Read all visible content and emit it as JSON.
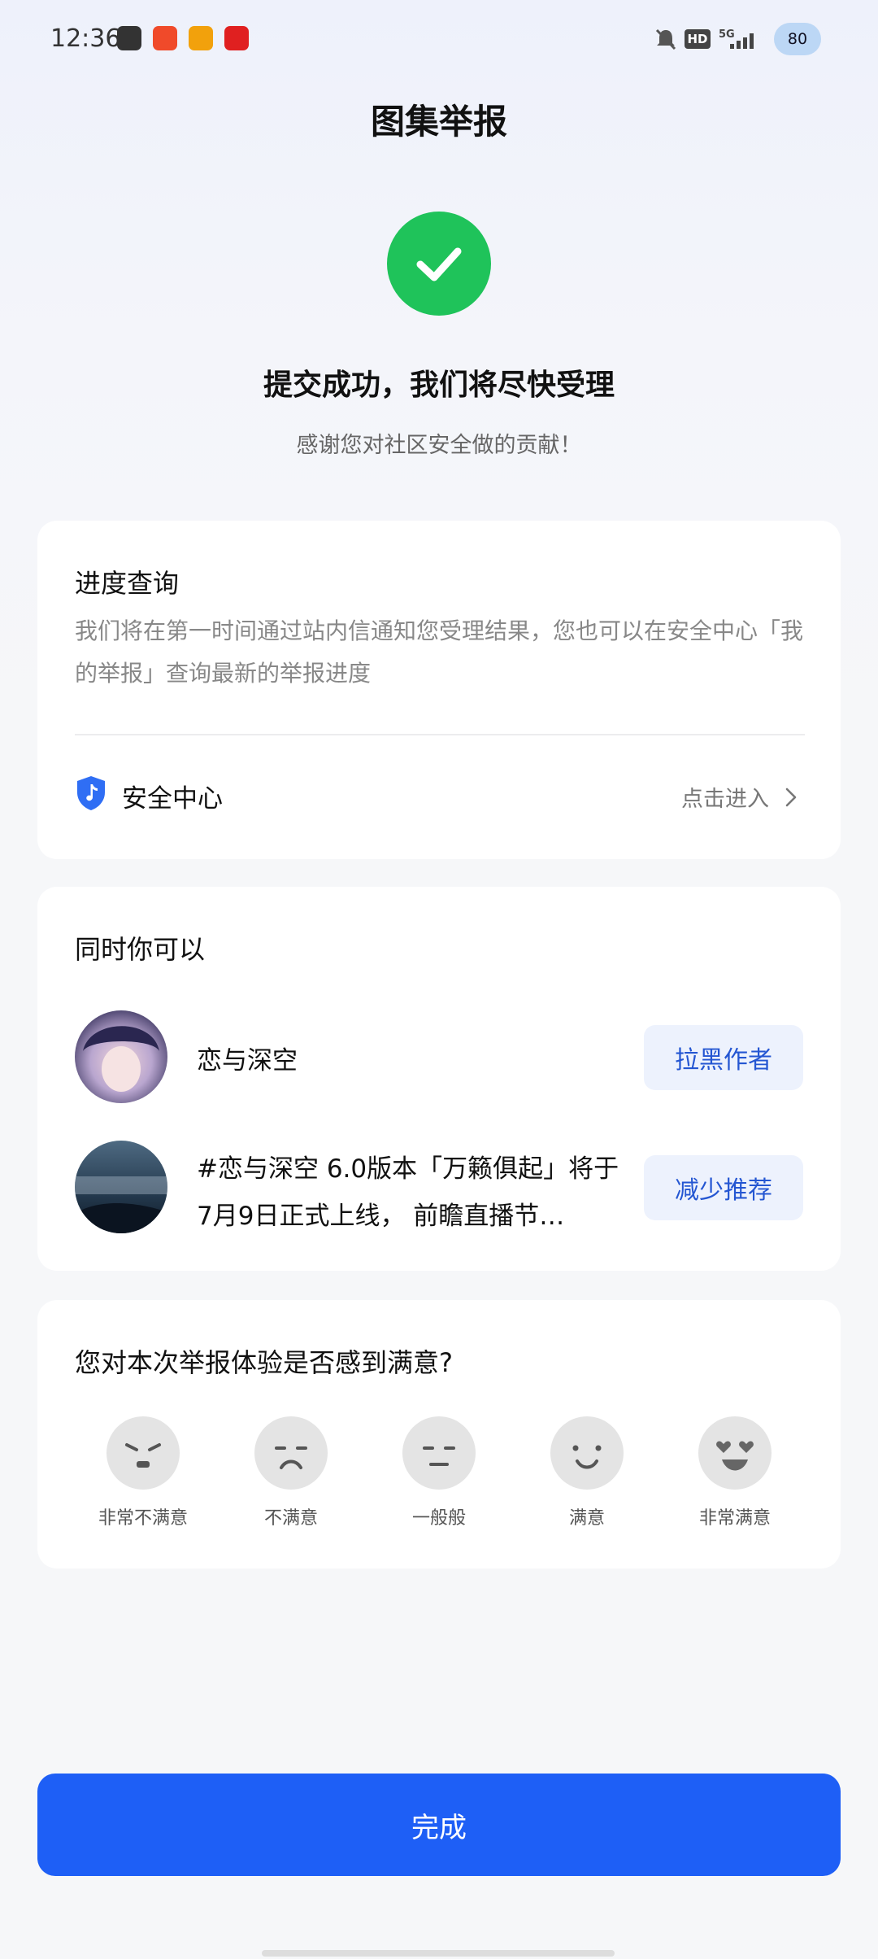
{
  "status_bar": {
    "time": "12:36",
    "battery": "80"
  },
  "page": {
    "title": "图集举报",
    "headline": "提交成功，我们将尽快受理",
    "subline": "感谢您对社区安全做的贡献！"
  },
  "progress": {
    "title": "进度查询",
    "description": "我们将在第一时间通过站内信通知您受理结果，您也可以在安全中心「我的举报」查询最新的举报进度",
    "security_center_label": "安全中心",
    "enter_label": "点击进入"
  },
  "actions": {
    "title": "同时你可以",
    "items": [
      {
        "text": "恋与深空",
        "button": "拉黑作者"
      },
      {
        "text": "#恋与深空 6.0版本「万籁俱起」将于7月9日正式上线， 前瞻直播节…",
        "button": "减少推荐"
      }
    ]
  },
  "survey": {
    "question": "您对本次举报体验是否感到满意?",
    "options": [
      "非常不满意",
      "不满意",
      "一般般",
      "满意",
      "非常满意"
    ]
  },
  "footer": {
    "done_label": "完成"
  },
  "colors": {
    "accent": "#1e5ff6",
    "success": "#1fc35a",
    "pill_bg": "#edf2fd",
    "pill_text": "#2456d2"
  },
  "icons": [
    "check-icon",
    "shield-icon",
    "chevron-right-icon",
    "face-icons"
  ]
}
